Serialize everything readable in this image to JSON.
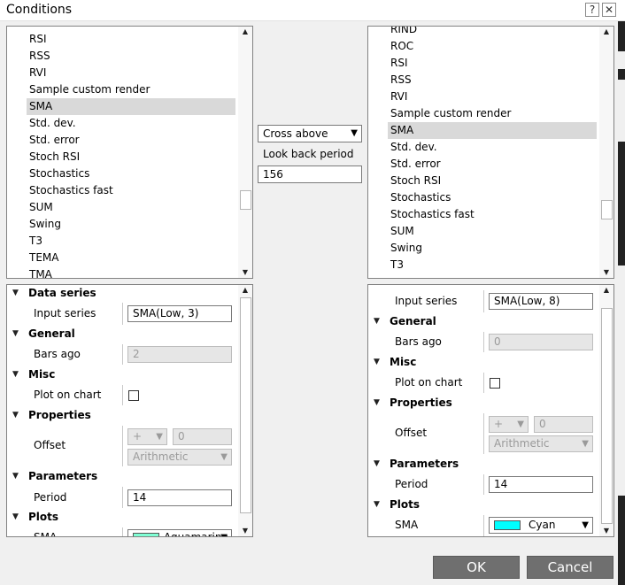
{
  "window": {
    "title": "Conditions",
    "help_glyph": "?",
    "close_glyph": "✕"
  },
  "left_list": {
    "items": [
      "RSI",
      "RSS",
      "RVI",
      "Sample custom render",
      "SMA",
      "Std. dev.",
      "Std. error",
      "Stoch RSI",
      "Stochastics",
      "Stochastics fast",
      "SUM",
      "Swing",
      "T3",
      "TEMA",
      "TMA"
    ],
    "selected": "SMA"
  },
  "right_list": {
    "items": [
      "RIND",
      "ROC",
      "RSI",
      "RSS",
      "RVI",
      "Sample custom render",
      "SMA",
      "Std. dev.",
      "Std. error",
      "Stoch RSI",
      "Stochastics",
      "Stochastics fast",
      "SUM",
      "Swing",
      "T3"
    ],
    "selected": "SMA"
  },
  "middle": {
    "condition": "Cross above",
    "look_back_label": "Look back period",
    "look_back_value": "156"
  },
  "left_props": {
    "data_series": "Data series",
    "input_series_label": "Input series",
    "input_series_value": "SMA(Low, 3)",
    "general": "General",
    "bars_ago_label": "Bars ago",
    "bars_ago_value": "2",
    "misc": "Misc",
    "plot_on_chart_label": "Plot on chart",
    "properties": "Properties",
    "offset_label": "Offset",
    "offset_op": "+",
    "offset_value": "0",
    "offset_type": "Arithmetic",
    "parameters": "Parameters",
    "period_label": "Period",
    "period_value": "14",
    "plots": "Plots",
    "sma_label": "SMA",
    "sma_color": "Aquamarine"
  },
  "right_props": {
    "input_series_label": "Input series",
    "input_series_value": "SMA(Low, 8)",
    "general": "General",
    "bars_ago_label": "Bars ago",
    "bars_ago_value": "0",
    "misc": "Misc",
    "plot_on_chart_label": "Plot on chart",
    "properties": "Properties",
    "offset_label": "Offset",
    "offset_op": "+",
    "offset_value": "0",
    "offset_type": "Arithmetic",
    "parameters": "Parameters",
    "period_label": "Period",
    "period_value": "14",
    "plots": "Plots",
    "sma_label": "SMA",
    "sma_color": "Cyan"
  },
  "buttons": {
    "ok": "OK",
    "cancel": "Cancel"
  },
  "colors": {
    "cyan": "#00ffff",
    "aquamarine": "#7fffd4",
    "button_bg": "#6f6f6f"
  }
}
